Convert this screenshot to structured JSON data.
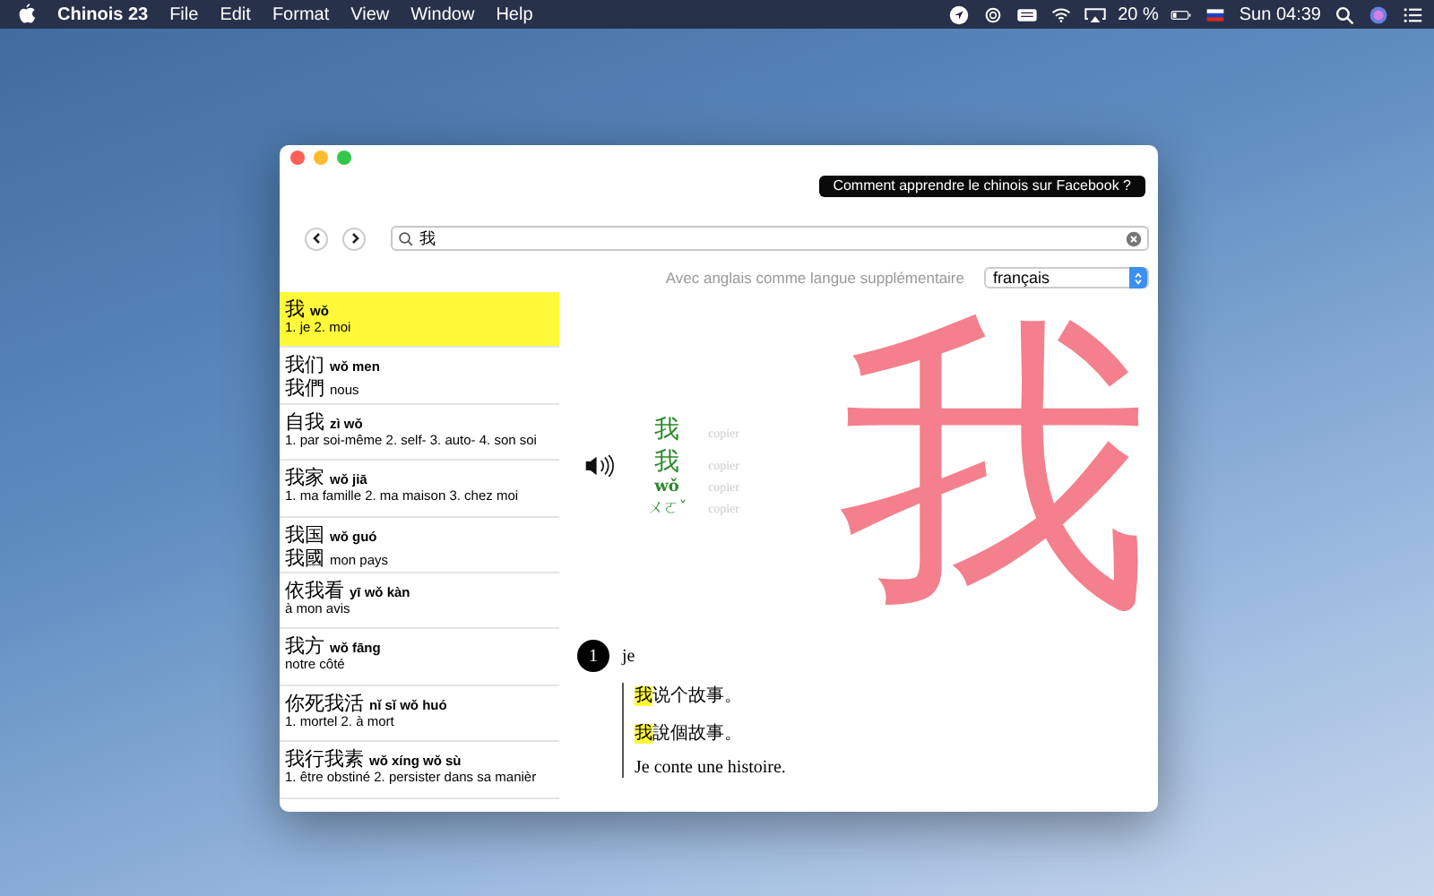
{
  "menu_bar": {
    "app": "Chinois 23",
    "items": [
      "File",
      "Edit",
      "Format",
      "View",
      "Window",
      "Help"
    ],
    "battery": "20 %",
    "clock": "Sun 04:39"
  },
  "window": {
    "facebook_button": "Comment apprendre le chinois sur Facebook ?",
    "search": {
      "value": "我"
    },
    "language_label": "Avec anglais comme langue supplémentaire",
    "language": "français",
    "results": [
      {
        "hanzi": "我",
        "pinyin": "wǒ",
        "meaning": "1. je 2. moi",
        "selected": true
      },
      {
        "hanzi": "我们",
        "pinyin": "wǒ men",
        "traditional": "我們",
        "meaning": "nous",
        "selected": false
      },
      {
        "hanzi": "自我",
        "pinyin": "zì wǒ",
        "meaning": "1. par soi-même 2. self- 3. auto- 4. son soi",
        "selected": false
      },
      {
        "hanzi": "我家",
        "pinyin": "wǒ jiā",
        "meaning": "1. ma famille 2. ma maison 3. chez moi",
        "selected": false
      },
      {
        "hanzi": "我国",
        "pinyin": "wǒ guó",
        "traditional": "我國",
        "meaning": "mon pays",
        "selected": false
      },
      {
        "hanzi": "依我看",
        "pinyin": "yī wǒ kàn",
        "meaning": "à mon avis",
        "selected": false
      },
      {
        "hanzi": "我方",
        "pinyin": "wǒ fāng",
        "meaning": "notre côté",
        "selected": false
      },
      {
        "hanzi": "你死我活",
        "pinyin": "nǐ sǐ wǒ huó",
        "meaning": "1. mortel 2. à mort",
        "selected": false
      },
      {
        "hanzi": "我行我素",
        "pinyin": "wǒ xíng wǒ sù",
        "meaning": "1. être obstiné 2. persister dans sa manièr",
        "selected": false
      }
    ],
    "entry": {
      "forms": [
        {
          "text": "我",
          "copy": "copier",
          "kind": "hanzi"
        },
        {
          "text": "我",
          "copy": "copier",
          "kind": "hanzi"
        },
        {
          "text": "wǒ",
          "copy": "copier",
          "kind": "pinyin"
        },
        {
          "text": "ㄨㄛˇ",
          "copy": "copier",
          "kind": "zhuyin"
        }
      ],
      "stroke_character": "我",
      "definitions": [
        {
          "number": "1",
          "meaning": "je",
          "examples": [
            {
              "highlight": "我",
              "rest": "说个故事。",
              "kind": "chinese"
            },
            {
              "highlight": "我",
              "rest": "說個故事。",
              "kind": "chinese"
            },
            {
              "rest": "Je conte une histoire.",
              "kind": "translation"
            }
          ]
        }
      ]
    }
  }
}
